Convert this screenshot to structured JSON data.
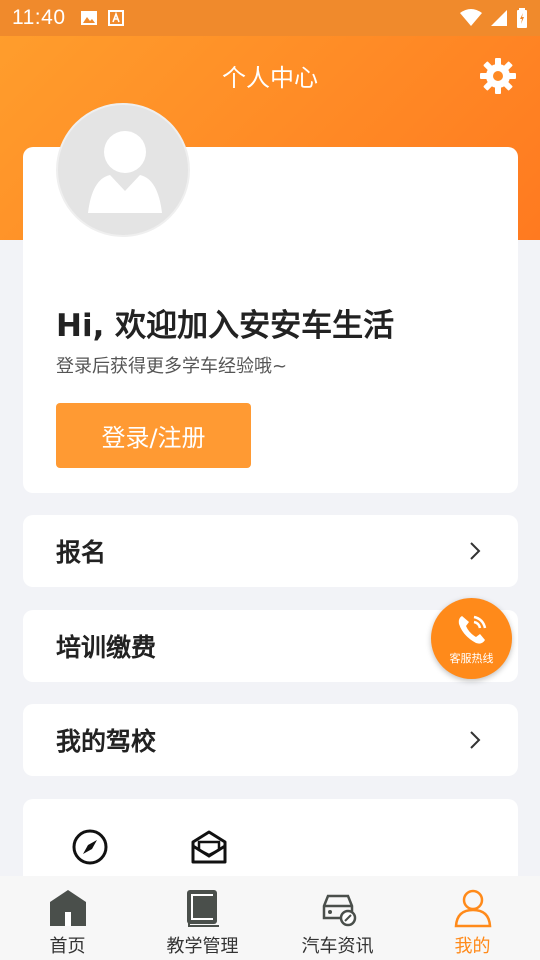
{
  "status": {
    "time": "11:40"
  },
  "header": {
    "title": "个人中心",
    "settings_icon": "gear-icon"
  },
  "profile": {
    "avatar_icon": "user-avatar-icon",
    "welcome": "Hi, 欢迎加入安安车生活",
    "subtext": "登录后获得更多学车经验哦~",
    "login_label": "登录/注册"
  },
  "menu": [
    {
      "label": "报名"
    },
    {
      "label": "培训缴费"
    },
    {
      "label": "我的驾校"
    }
  ],
  "fab": {
    "label": "客服热线",
    "icon": "phone-icon"
  },
  "grid_icons": [
    "compass-icon",
    "mail-icon"
  ],
  "nav": [
    {
      "label": "首页",
      "icon": "home-icon",
      "active": false
    },
    {
      "label": "教学管理",
      "icon": "book-icon",
      "active": false
    },
    {
      "label": "汽车资讯",
      "icon": "car-icon",
      "active": false
    },
    {
      "label": "我的",
      "icon": "person-icon",
      "active": true
    }
  ],
  "colors": {
    "accent": "#ff8a1a",
    "header_start": "#ff9d2c",
    "header_end": "#ff7a20"
  }
}
